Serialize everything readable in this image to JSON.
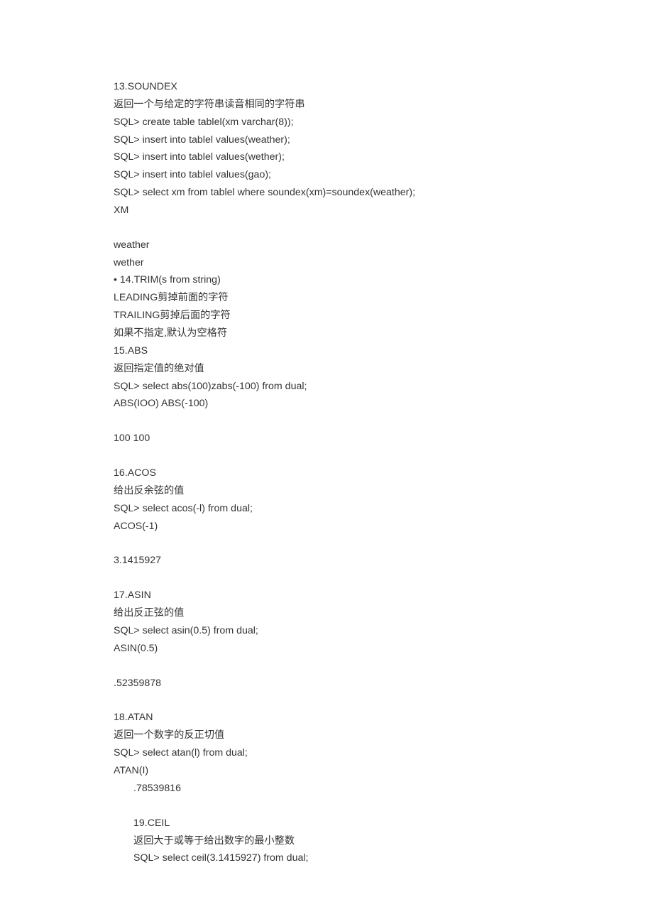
{
  "lines": [
    {
      "text": "13.SOUNDEX",
      "indent": false
    },
    {
      "text": "返回一个与给定的字符串读音相同的字符串",
      "indent": false
    },
    {
      "text": "SQL> create table tablel(xm varchar(8));",
      "indent": false
    },
    {
      "text": "SQL> insert into tablel values(weather);",
      "indent": false
    },
    {
      "text": "SQL> insert into tablel values(wether);",
      "indent": false
    },
    {
      "text": "SQL> insert into tablel values(gao);",
      "indent": false
    },
    {
      "text": "SQL> select xm from tablel where soundex(xm)=soundex(weather);",
      "indent": false
    },
    {
      "text": "XM",
      "indent": false
    },
    {
      "blank": true
    },
    {
      "text": "weather",
      "indent": false
    },
    {
      "text": "wether",
      "indent": false
    },
    {
      "text": "• 14.TRIM(s from string)",
      "indent": false
    },
    {
      "text": "LEADING剪掉前面的字符",
      "indent": false
    },
    {
      "text": "TRAILING剪掉后面的字符",
      "indent": false
    },
    {
      "text": "如果不指定,默认为空格符",
      "indent": false
    },
    {
      "text": "15.ABS",
      "indent": false
    },
    {
      "text": "返回指定值的绝对值",
      "indent": false
    },
    {
      "text": "SQL> select abs(100)zabs(-100) from dual;",
      "indent": false
    },
    {
      "text": "ABS(IOO) ABS(-100)",
      "indent": false
    },
    {
      "blank": true
    },
    {
      "text": "100 100",
      "indent": false
    },
    {
      "blank": true
    },
    {
      "text": "16.ACOS",
      "indent": false
    },
    {
      "text": "给出反余弦的值",
      "indent": false
    },
    {
      "text": "SQL> select acos(-l) from dual;",
      "indent": false
    },
    {
      "text": "ACOS(-1)",
      "indent": false
    },
    {
      "blank": true
    },
    {
      "text": "3.1415927",
      "indent": false
    },
    {
      "blank": true
    },
    {
      "text": "17.ASIN",
      "indent": false
    },
    {
      "text": "给出反正弦的值",
      "indent": false
    },
    {
      "text": "SQL> select asin(0.5) from dual;",
      "indent": false
    },
    {
      "text": "ASIN(0.5)",
      "indent": false
    },
    {
      "blank": true
    },
    {
      "text": ".52359878",
      "indent": false
    },
    {
      "blank": true
    },
    {
      "text": "18.ATAN",
      "indent": false
    },
    {
      "text": "返回一个数字的反正切值",
      "indent": false
    },
    {
      "text": "SQL> select atan(l) from dual;",
      "indent": false
    },
    {
      "text": "ATAN(I)",
      "indent": false
    },
    {
      "text": ".78539816",
      "indent": true
    },
    {
      "blank": true
    },
    {
      "text": "19.CEIL",
      "indent": true
    },
    {
      "text": "返回大于或等于给出数字的最小整数",
      "indent": true
    },
    {
      "text": "SQL> select ceil(3.1415927) from dual;",
      "indent": true
    }
  ]
}
